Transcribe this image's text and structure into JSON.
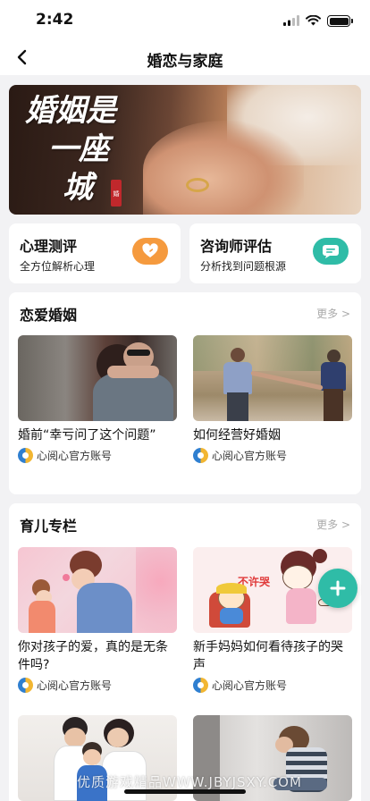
{
  "status_bar": {
    "time": "2:42"
  },
  "nav": {
    "title": "婚恋与家庭"
  },
  "banner": {
    "line1": "婚姻是",
    "line2": "一座",
    "line3": "城"
  },
  "quick_cards": [
    {
      "title": "心理测评",
      "subtitle": "全方位解析心理",
      "icon": "heart-icon",
      "color": "#f59a3e"
    },
    {
      "title": "咨询师评估",
      "subtitle": "分析找到问题根源",
      "icon": "message-icon",
      "color": "#2fbca7"
    }
  ],
  "sections": [
    {
      "title": "恋爱婚姻",
      "more": "更多 >",
      "articles": [
        {
          "title": "婚前“幸亏问了这个问题”",
          "author": "心阅心官方账号"
        },
        {
          "title": "如何经营好婚姻",
          "author": "心阅心官方账号"
        }
      ]
    },
    {
      "title": "育儿专栏",
      "more": "更多 >",
      "articles": [
        {
          "title": "你对孩子的爱，真的是无条件吗?",
          "author": "心阅心官方账号",
          "image_caption": ""
        },
        {
          "title": "新手妈妈如何看待孩子的哭声",
          "author": "心阅心官方账号",
          "image_caption": "不许哭"
        }
      ]
    }
  ],
  "watermark": "优质游戏精品WWW.JBYJSXY.COM",
  "colors": {
    "accent": "#2fbca7",
    "orange": "#f59a3e",
    "more_text": "#aaaaaa"
  }
}
